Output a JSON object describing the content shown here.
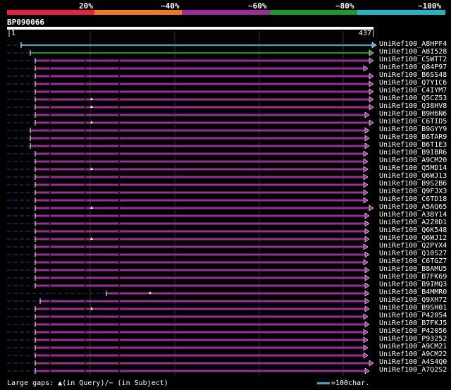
{
  "legend": {
    "labels": [
      "20%",
      "~40%",
      "~60%",
      "~80%",
      "~100%"
    ],
    "colors": [
      "#e8213d",
      "#ef7a1f",
      "#9a2d9a",
      "#1a9a2a",
      "#22b5c5"
    ]
  },
  "query": {
    "name": "BP090066",
    "start": "1",
    "end": "437"
  },
  "hits": [
    {
      "name": "UniRef100_A8HPF4",
      "color": "#22b5c5",
      "start": 30,
      "end": 528,
      "kind": "line"
    },
    {
      "name": "UniRef100_A8I528",
      "color": "#1a9a2a",
      "start": 43,
      "end": 524,
      "kind": "line"
    },
    {
      "name": "UniRef100_C5WTT2",
      "color": "#9a2d9a",
      "start": 50,
      "end": 524
    },
    {
      "name": "UniRef100_Q84P97",
      "color": "#9a2d9a",
      "start": 50,
      "end": 516
    },
    {
      "name": "UniRef100_B6SS48",
      "color": "#9a2d9a",
      "start": 50,
      "end": 524
    },
    {
      "name": "UniRef100_Q7Y1C6",
      "color": "#9a2d9a",
      "start": 50,
      "end": 524
    },
    {
      "name": "UniRef100_C4IYM7",
      "color": "#9a2d9a",
      "start": 50,
      "end": 524
    },
    {
      "name": "UniRef100_Q5CZ53",
      "color": "#9a2d9a",
      "start": 50,
      "end": 524,
      "gap": true
    },
    {
      "name": "UniRef100_Q38HV8",
      "color": "#9a2d9a",
      "start": 50,
      "end": 524,
      "gap": true
    },
    {
      "name": "UniRef100_B9H6N6",
      "color": "#9a2d9a",
      "start": 50,
      "end": 518
    },
    {
      "name": "UniRef100_C6TID5",
      "color": "#9a2d9a",
      "start": 50,
      "end": 524,
      "gap": true
    },
    {
      "name": "UniRef100_B9GYY9",
      "color": "#9a2d9a",
      "start": 43,
      "end": 518
    },
    {
      "name": "UniRef100_B6TAR9",
      "color": "#9a2d9a",
      "start": 43,
      "end": 518
    },
    {
      "name": "UniRef100_B6T1E3",
      "color": "#9a2d9a",
      "start": 43,
      "end": 518
    },
    {
      "name": "UniRef100_B9IBR6",
      "color": "#9a2d9a",
      "start": 50,
      "end": 516
    },
    {
      "name": "UniRef100_A9CM20",
      "color": "#9a2d9a",
      "start": 50,
      "end": 516
    },
    {
      "name": "UniRef100_Q5MD14",
      "color": "#9a2d9a",
      "start": 50,
      "end": 516,
      "gap": true
    },
    {
      "name": "UniRef100_Q6WJ13",
      "color": "#9a2d9a",
      "start": 50,
      "end": 516
    },
    {
      "name": "UniRef100_B9S2B6",
      "color": "#9a2d9a",
      "start": 50,
      "end": 516
    },
    {
      "name": "UniRef100_Q9FJX3",
      "color": "#9a2d9a",
      "start": 50,
      "end": 516
    },
    {
      "name": "UniRef100_C6TD18",
      "color": "#9a2d9a",
      "start": 50,
      "end": 516
    },
    {
      "name": "UniRef100_A5AQ65",
      "color": "#9a2d9a",
      "start": 50,
      "end": 524,
      "gap": true
    },
    {
      "name": "UniRef100_A3BY14",
      "color": "#9a2d9a",
      "start": 50,
      "end": 518
    },
    {
      "name": "UniRef100_A2Z0D1",
      "color": "#9a2d9a",
      "start": 50,
      "end": 518
    },
    {
      "name": "UniRef100_Q6K548",
      "color": "#9a2d9a",
      "start": 50,
      "end": 518
    },
    {
      "name": "UniRef100_Q6WJ12",
      "color": "#9a2d9a",
      "start": 50,
      "end": 518,
      "gap": true
    },
    {
      "name": "UniRef100_Q2PYX4",
      "color": "#9a2d9a",
      "start": 50,
      "end": 516
    },
    {
      "name": "UniRef100_Q10S27",
      "color": "#9a2d9a",
      "start": 50,
      "end": 518
    },
    {
      "name": "UniRef100_C6TGZ7",
      "color": "#9a2d9a",
      "start": 50,
      "end": 516
    },
    {
      "name": "UniRef100_B8AMU5",
      "color": "#9a2d9a",
      "start": 50,
      "end": 518
    },
    {
      "name": "UniRef100_B7FK69",
      "color": "#9a2d9a",
      "start": 50,
      "end": 518
    },
    {
      "name": "UniRef100_B9IMQ3",
      "color": "#9a2d9a",
      "start": 50,
      "end": 518
    },
    {
      "name": "UniRef100_B4MMR0",
      "color": "#9a2d9a",
      "start": 151,
      "end": 518,
      "gap": true
    },
    {
      "name": "UniRef100_Q9XH72",
      "color": "#9a2d9a",
      "start": 57,
      "end": 518
    },
    {
      "name": "UniRef100_B9SH01",
      "color": "#9a2d9a",
      "start": 50,
      "end": 518,
      "gap": true
    },
    {
      "name": "UniRef100_P42054",
      "color": "#9a2d9a",
      "start": 50,
      "end": 516
    },
    {
      "name": "UniRef100_B7FKJ5",
      "color": "#9a2d9a",
      "start": 50,
      "end": 518
    },
    {
      "name": "UniRef100_P42056",
      "color": "#9a2d9a",
      "start": 50,
      "end": 516
    },
    {
      "name": "UniRef100_P93252",
      "color": "#9a2d9a",
      "start": 50,
      "end": 516
    },
    {
      "name": "UniRef100_A9CM21",
      "color": "#9a2d9a",
      "start": 50,
      "end": 516
    },
    {
      "name": "UniRef100_A9CM22",
      "color": "#9a2d9a",
      "start": 50,
      "end": 516
    },
    {
      "name": "UniRef100_A4S4Q0",
      "color": "#9a2d9a",
      "start": 50,
      "end": 524
    },
    {
      "name": "UniRef100_A7Q2S2",
      "color": "#9a2d9a",
      "start": 50,
      "end": 518
    }
  ],
  "footer": {
    "left": "Large gaps: ▲(in Query)/− (in Subject)",
    "right": "=100char."
  }
}
